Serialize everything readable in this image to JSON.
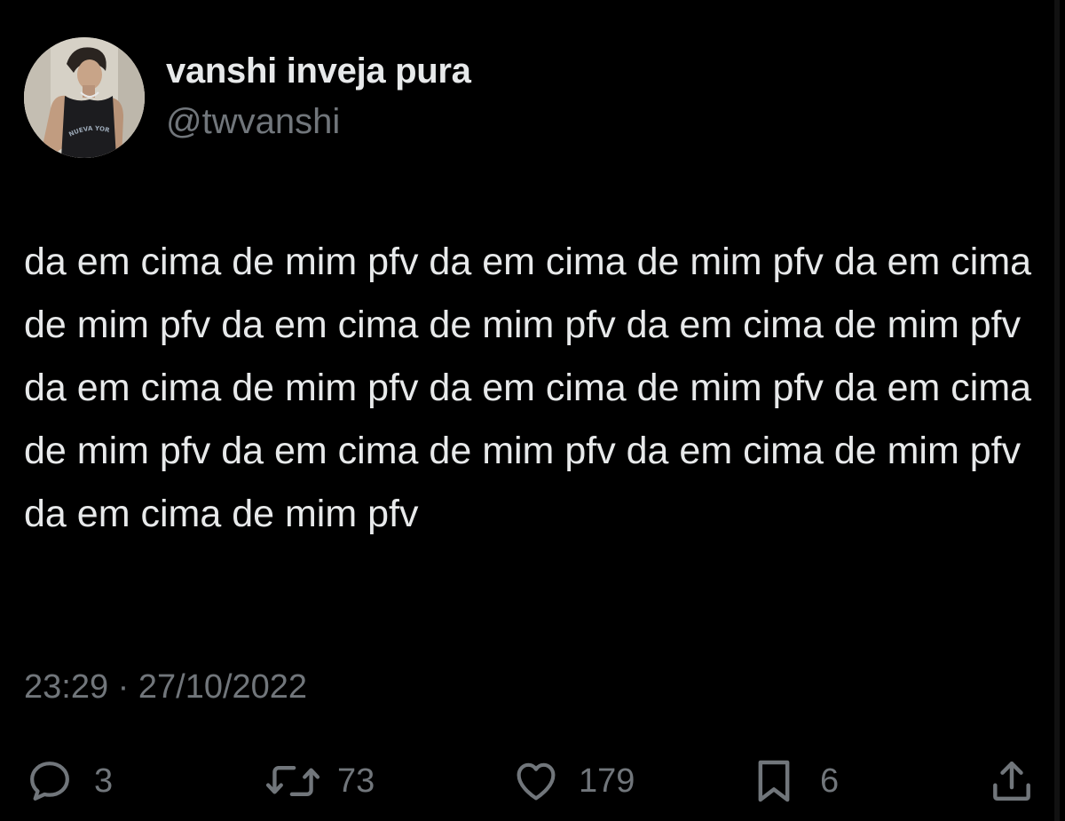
{
  "author": {
    "display_name": "vanshi inveja pura",
    "handle": "@twvanshi",
    "avatar_text": "NUEVA YORK"
  },
  "tweet": {
    "text": "da em cima de mim pfv da em cima de mim pfv da em cima de mim pfv da em cima de mim pfv da em cima de mim pfv da em cima de mim pfv da em cima de mim pfv da em cima de mim pfv da em cima de mim pfv da em cima de mim pfv da em cima de mim pfv",
    "time": "23:29",
    "separator": "·",
    "date": "27/10/2022"
  },
  "actions": {
    "reply": {
      "icon": "reply-icon",
      "count": "3"
    },
    "retweet": {
      "icon": "retweet-icon",
      "count": "73"
    },
    "like": {
      "icon": "heart-icon",
      "count": "179"
    },
    "bookmark": {
      "icon": "bookmark-icon",
      "count": "6"
    },
    "share": {
      "icon": "share-icon"
    }
  },
  "colors": {
    "background": "#000000",
    "primary_text": "#e7e9ea",
    "secondary_text": "#71767b"
  }
}
